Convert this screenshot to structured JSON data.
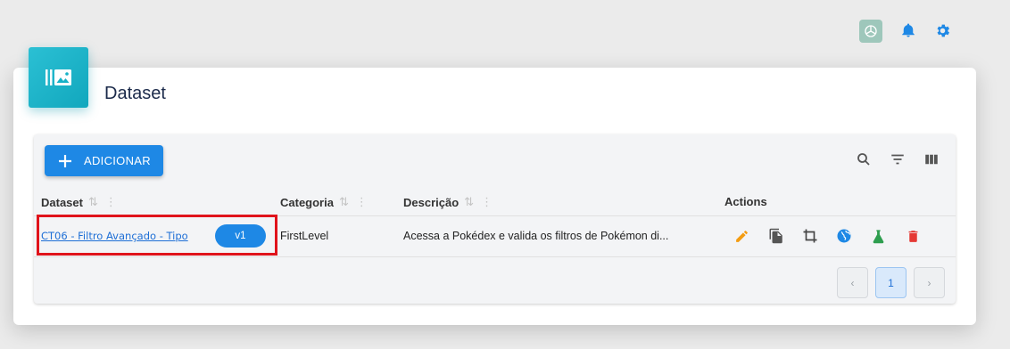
{
  "header": {
    "icons": [
      "openai-icon",
      "bell-icon",
      "gear-icon"
    ]
  },
  "card": {
    "title": "Dataset",
    "logo_icon": "dataset-library-icon"
  },
  "toolbar": {
    "add_label": "ADICIONAR",
    "icons": [
      "search-icon",
      "filter-icon",
      "columns-icon"
    ]
  },
  "table": {
    "columns": [
      {
        "label": "Dataset"
      },
      {
        "label": "Categoria"
      },
      {
        "label": "Descrição"
      },
      {
        "label": "Actions"
      }
    ],
    "rows": [
      {
        "dataset": "CT06 - Filtro Avançado - Tipo",
        "version": "v1",
        "categoria": "FirstLevel",
        "descricao": "Acessa a Pokédex e valida os filtros de Pokémon di...",
        "actions": [
          "edit-icon",
          "copy-icon",
          "crop-icon",
          "globe-icon",
          "flask-icon",
          "delete-icon"
        ]
      }
    ]
  },
  "pagination": {
    "prev": "‹",
    "current": "1",
    "next": "›"
  },
  "colors": {
    "primary": "#1e88e5",
    "accent_teal": "#17b2c7",
    "highlight": "#e0131b",
    "edit": "#f39c12",
    "flask": "#2e9e4f",
    "delete": "#e53935"
  }
}
